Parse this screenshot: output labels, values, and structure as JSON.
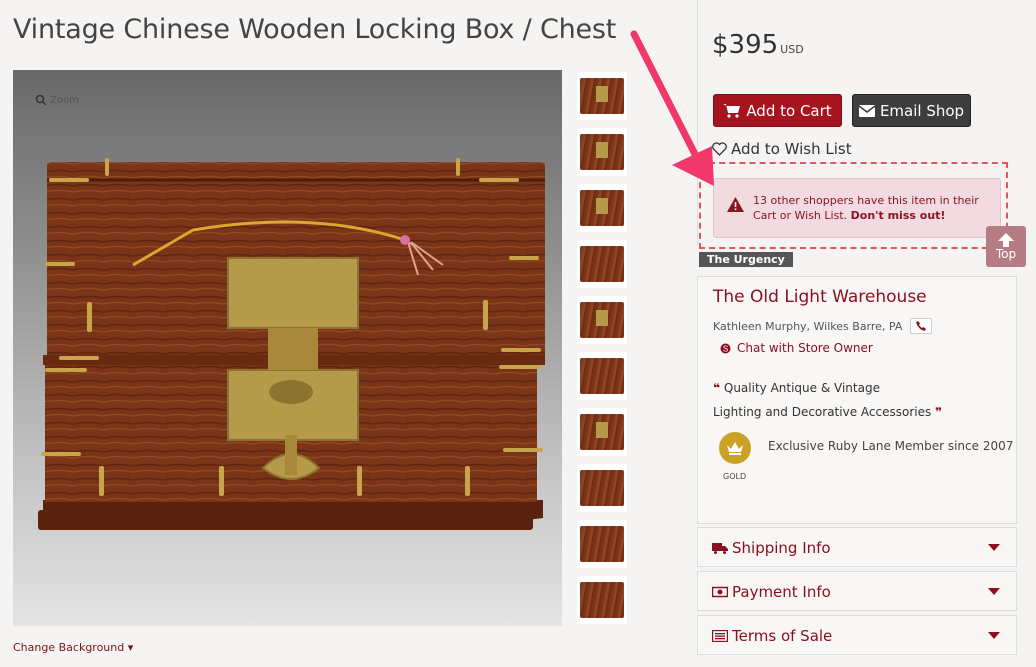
{
  "product": {
    "title": "Vintage Chinese Wooden Locking Box / Chest",
    "price": "$395",
    "currency": "USD",
    "zoom_label": "Zoom",
    "thumbnail_count": 10,
    "change_background_label": "Change Background"
  },
  "actions": {
    "add_to_cart": "Add to Cart",
    "email_shop": "Email Shop",
    "add_to_wishlist": "Add to Wish List"
  },
  "urgency": {
    "message": "13 other shoppers have this item in their Cart or Wish List.",
    "emphasis": "Don't miss out!",
    "label": "The Urgency"
  },
  "top_button": {
    "label": "Top"
  },
  "shop": {
    "name": "The Old Light Warehouse",
    "owner": "Kathleen Murphy, Wilkes Barre, PA",
    "chat_label": "Chat with Store Owner",
    "tagline_line1": "Quality Antique & Vintage",
    "tagline_line2": "Lighting and Decorative Accessories",
    "badge_label": "GOLD",
    "member_since": "Exclusive Ruby Lane Member since 2007"
  },
  "accordion": {
    "shipping": "Shipping Info",
    "payment": "Payment Info",
    "terms": "Terms of Sale"
  },
  "colors": {
    "accent": "#8a1020",
    "cart_button": "#a5141f",
    "email_button": "#3d3d3d",
    "alert_bg": "#f1dbe0",
    "annotation_arrow": "#f0386b"
  },
  "icons": [
    "search-icon",
    "cart-icon",
    "envelope-icon",
    "heart-icon",
    "warning-icon",
    "arrow-up-icon",
    "phone-icon",
    "skype-icon",
    "quote-icon",
    "crown-icon",
    "truck-icon",
    "money-icon",
    "list-icon",
    "chevron-down-icon"
  ]
}
